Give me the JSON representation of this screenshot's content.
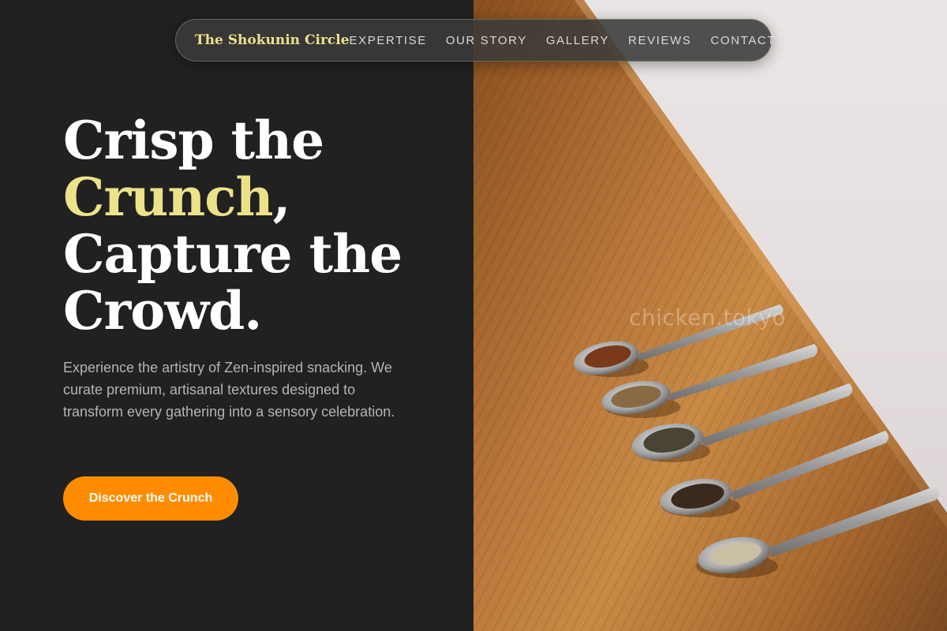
{
  "nav": {
    "brand": "The Shokunin Circle",
    "links": [
      "EXPERTISE",
      "OUR STORY",
      "GALLERY",
      "REVIEWS",
      "CONTACT"
    ]
  },
  "hero": {
    "headline_1": "Crisp the",
    "headline_accent": "Crunch",
    "headline_2": ",",
    "headline_3": "Capture the",
    "headline_4": "Crowd.",
    "description": "Experience the artistry of Zen-inspired snacking. We curate premium, artisanal textures designed to transform every gathering into a sensory celebration.",
    "cta_label": "Discover the Crunch"
  },
  "image": {
    "watermark": "chicken.tokyo"
  },
  "colors": {
    "background": "#212121",
    "brand": "#ede08a",
    "accent": "#ece28a",
    "cta": "#ff8c00"
  }
}
